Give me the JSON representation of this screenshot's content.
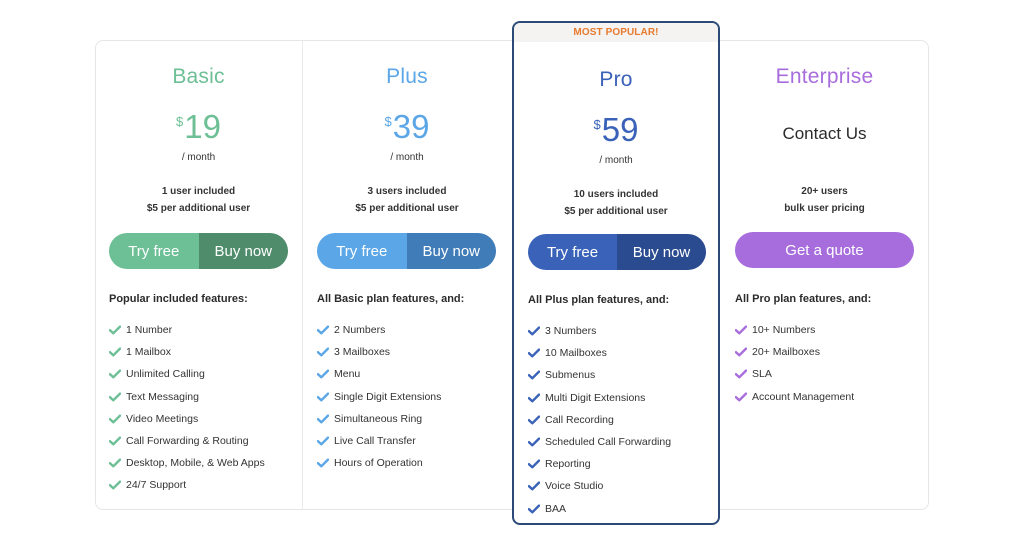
{
  "colors": {
    "basic": "#6dbf95",
    "basic_dark": "#4e8c6b",
    "plus": "#5aa6e6",
    "plus_dark": "#3f7cb8",
    "pro": "#3a62b8",
    "pro_dark": "#2a4b8f",
    "enterprise": "#a86ddd",
    "badge_text": "#e77a2e"
  },
  "plans": [
    {
      "name": "Basic",
      "currency": "$",
      "price": "19",
      "period": "/ month",
      "users_line1": "1 user included",
      "users_line2": "$5 per additional user",
      "try_label": "Try free",
      "buy_label": "Buy now",
      "features_title": "Popular included features:",
      "features": [
        "1 Number",
        "1 Mailbox",
        "Unlimited Calling",
        "Text Messaging",
        "Video Meetings",
        "Call Forwarding & Routing",
        "Desktop, Mobile, & Web Apps",
        "24/7 Support"
      ]
    },
    {
      "name": "Plus",
      "currency": "$",
      "price": "39",
      "period": "/ month",
      "users_line1": "3 users included",
      "users_line2": "$5 per additional user",
      "try_label": "Try free",
      "buy_label": "Buy now",
      "features_title": "All Basic plan features, and:",
      "features": [
        "2 Numbers",
        "3 Mailboxes",
        "Menu",
        "Single Digit Extensions",
        "Simultaneous Ring",
        "Live Call Transfer",
        "Hours of Operation"
      ]
    },
    {
      "badge": "MOST POPULAR!",
      "name": "Pro",
      "currency": "$",
      "price": "59",
      "period": "/ month",
      "users_line1": "10 users included",
      "users_line2": "$5 per additional user",
      "try_label": "Try free",
      "buy_label": "Buy now",
      "features_title": "All Plus plan features, and:",
      "features": [
        "3 Numbers",
        "10 Mailboxes",
        "Submenus",
        "Multi Digit Extensions",
        "Call Recording",
        "Scheduled Call Forwarding",
        "Reporting",
        "Voice Studio",
        "BAA"
      ]
    },
    {
      "name": "Enterprise",
      "contact": "Contact Us",
      "users_line1": "20+ users",
      "users_line2": "bulk user pricing",
      "quote_label": "Get a quote",
      "features_title": "All Pro plan features, and:",
      "features": [
        "10+ Numbers",
        "20+ Mailboxes",
        "SLA",
        "Account Management"
      ]
    }
  ]
}
